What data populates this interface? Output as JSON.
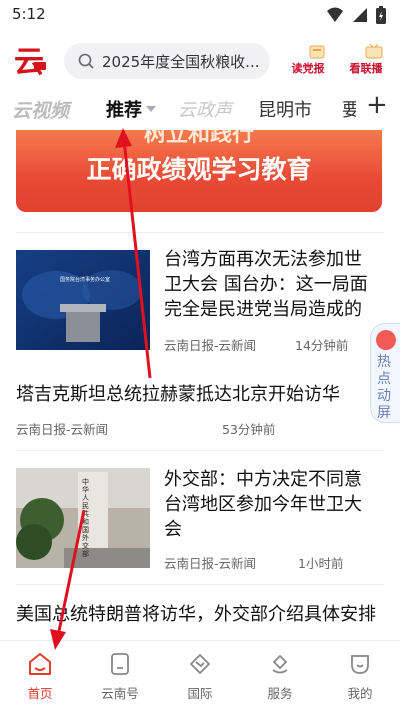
{
  "status_bar": {
    "time": "5:12"
  },
  "header": {
    "search_placeholder": "2025年度全国秋粮收...",
    "btn_read_party": "读党报",
    "btn_live": "看联播"
  },
  "tabs": {
    "video": "云视频",
    "recommend": "推荐",
    "yunzheng": "云政声",
    "kunming": "昆明市",
    "partial": "要",
    "add": "+"
  },
  "banner": {
    "top_text": "树立和践行",
    "main_text": "正确政绩观学习教育"
  },
  "news": [
    {
      "title": "台湾方面再次无法参加世卫大会 国台办：这一局面完全是民进党当局造成的",
      "source": "云南日报-云新闻",
      "time": "14分钟前",
      "image_caption": "国务院台湾事务办公室"
    },
    {
      "title": "塔吉克斯坦总统拉赫蒙抵达北京开始访华",
      "source": "云南日报-云新闻",
      "time": "53分钟前"
    },
    {
      "title": "外交部：中方决定不同意台湾地区参加今年世卫大会",
      "source": "云南日报-云新闻",
      "time": "1小时前",
      "image_caption": "中华人民共和国外交部"
    },
    {
      "title": "美国总统特朗普将访华，外交部介绍具体安排"
    }
  ],
  "hot_tab": {
    "label": "热点动屏"
  },
  "bottom_nav": [
    {
      "label": "首页",
      "icon": "home-icon",
      "active": true
    },
    {
      "label": "云南号",
      "icon": "yunnan-hao-icon"
    },
    {
      "label": "国际",
      "icon": "globe-icon"
    },
    {
      "label": "服务",
      "icon": "service-icon"
    },
    {
      "label": "我的",
      "icon": "profile-icon"
    }
  ],
  "colors": {
    "accent": "#e23c2c",
    "banner": "#e94a36",
    "annotation": "#e0101e"
  }
}
